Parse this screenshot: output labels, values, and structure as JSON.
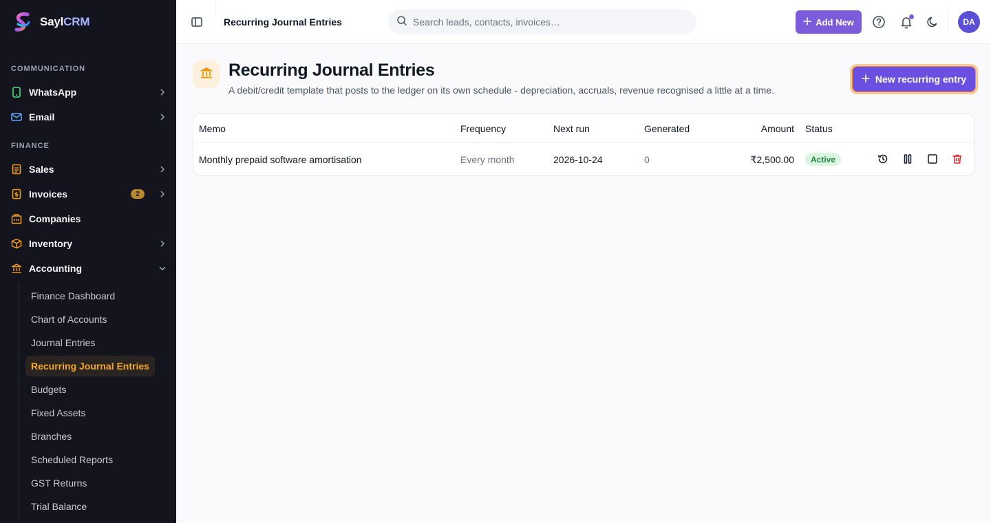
{
  "brand": {
    "name_main": "Sayl",
    "name_accent": "CRM"
  },
  "sidebar": {
    "sections": [
      {
        "label": "COMMUNICATION"
      },
      {
        "label": "FINANCE"
      }
    ],
    "items": [
      {
        "label": "WhatsApp"
      },
      {
        "label": "Email"
      },
      {
        "label": "Sales"
      },
      {
        "label": "Invoices",
        "badge": "2"
      },
      {
        "label": "Companies"
      },
      {
        "label": "Inventory"
      },
      {
        "label": "Accounting"
      }
    ],
    "accounting_sub": [
      {
        "label": "Finance Dashboard"
      },
      {
        "label": "Chart of Accounts"
      },
      {
        "label": "Journal Entries"
      },
      {
        "label": "Recurring Journal Entries"
      },
      {
        "label": "Budgets"
      },
      {
        "label": "Fixed Assets"
      },
      {
        "label": "Branches"
      },
      {
        "label": "Scheduled Reports"
      },
      {
        "label": "GST Returns"
      },
      {
        "label": "Trial Balance"
      }
    ]
  },
  "topbar": {
    "title": "Recurring Journal Entries",
    "search_placeholder": "Search leads, contacts, invoices…",
    "add_new_label": "Add New",
    "avatar_initials": "DA"
  },
  "page": {
    "title": "Recurring Journal Entries",
    "subtitle": "A debit/credit template that posts to the ledger on its own schedule - depreciation, accruals, revenue recognised a little at a time.",
    "new_button_label": "New recurring entry"
  },
  "table": {
    "headers": {
      "memo": "Memo",
      "frequency": "Frequency",
      "next_run": "Next run",
      "generated": "Generated",
      "amount": "Amount",
      "status": "Status"
    },
    "rows": [
      {
        "memo": "Monthly prepaid software amortisation",
        "frequency": "Every month",
        "next_run": "2026-10-24",
        "generated": "0",
        "amount": "₹2,500.00",
        "status": "Active"
      }
    ]
  },
  "colors": {
    "accent": "#6b4fe0",
    "sidebar_bg": "#14141f",
    "active_nav": "#f5a623",
    "status_active": "#23863f"
  }
}
